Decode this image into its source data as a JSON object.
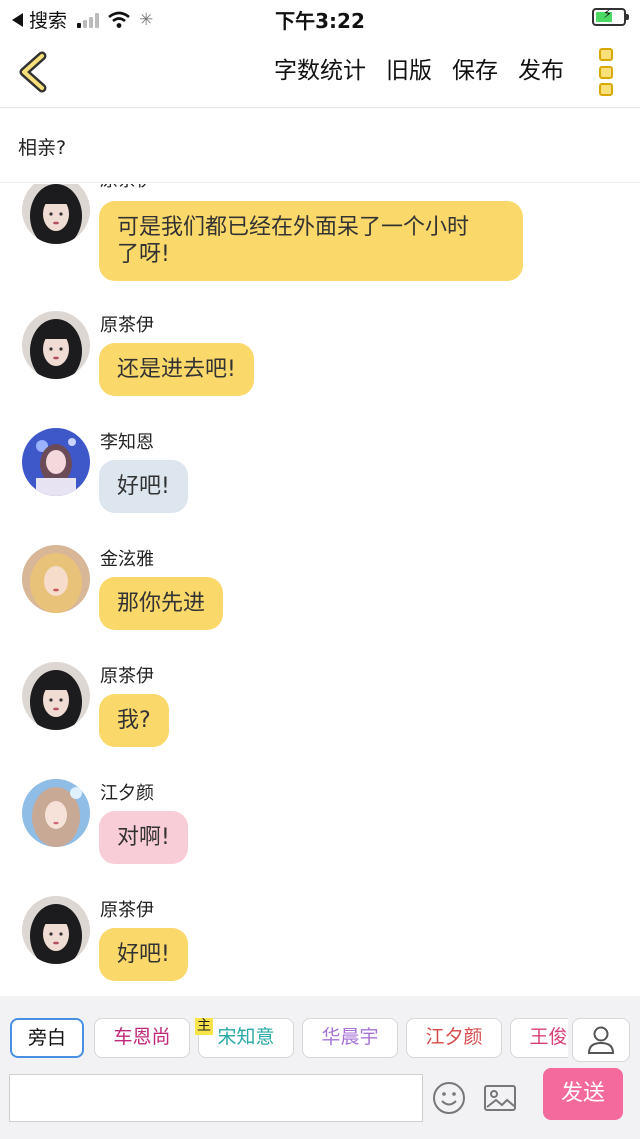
{
  "status_bar": {
    "back_app_label": "搜索",
    "time": "下午3:22"
  },
  "nav": {
    "actions": [
      "字数统计",
      "旧版",
      "保存",
      "发布"
    ]
  },
  "story": {
    "title": "相亲?"
  },
  "messages": [
    {
      "sender": "原茶伊",
      "text_lines": [
        "可是我们都已经在外面呆了一个小时",
        "了呀!"
      ],
      "color": "#fbd86a",
      "avatar": "yuan-chayi"
    },
    {
      "sender": "原茶伊",
      "text_lines": [
        "还是进去吧!"
      ],
      "color": "#fbd86a",
      "avatar": "yuan-chayi"
    },
    {
      "sender": "李知恩",
      "text_lines": [
        "好吧!"
      ],
      "color": "#dde5ee",
      "avatar": "li-zhien"
    },
    {
      "sender": "金泫雅",
      "text_lines": [
        "那你先进"
      ],
      "color": "#fbd86a",
      "avatar": "jin-xuanya"
    },
    {
      "sender": "原茶伊",
      "text_lines": [
        "我?"
      ],
      "color": "#fbd86a",
      "avatar": "yuan-chayi"
    },
    {
      "sender": "江夕颜",
      "text_lines": [
        "对啊!"
      ],
      "color": "#f8cdd8",
      "avatar": "jiang-xiyan"
    },
    {
      "sender": "原茶伊",
      "text_lines": [
        "好吧!"
      ],
      "color": "#fbd86a",
      "avatar": "yuan-chayi"
    }
  ],
  "character_tabs": [
    {
      "label": "旁白",
      "color": "#111111",
      "active": true
    },
    {
      "label": "车恩尚",
      "color": "#c0287a"
    },
    {
      "label": "宋知意",
      "color": "#2aa8a8",
      "badge": "主"
    },
    {
      "label": "华晨宇",
      "color": "#a774d6"
    },
    {
      "label": "江夕颜",
      "color": "#d64a4a"
    },
    {
      "label": "王俊凯",
      "color": "#d9407a"
    }
  ],
  "composer": {
    "input_value": "",
    "send_label": "发送"
  },
  "icons": [
    "back-chevron-icon",
    "more-vertical-icon",
    "person-icon",
    "emoji-icon",
    "image-icon",
    "wifi-icon",
    "signal-icon",
    "battery-icon"
  ],
  "colors": {
    "accent_yellow": "#fbd86a",
    "send_pink": "#f56a9c",
    "active_tab_border": "#4a90e2"
  }
}
